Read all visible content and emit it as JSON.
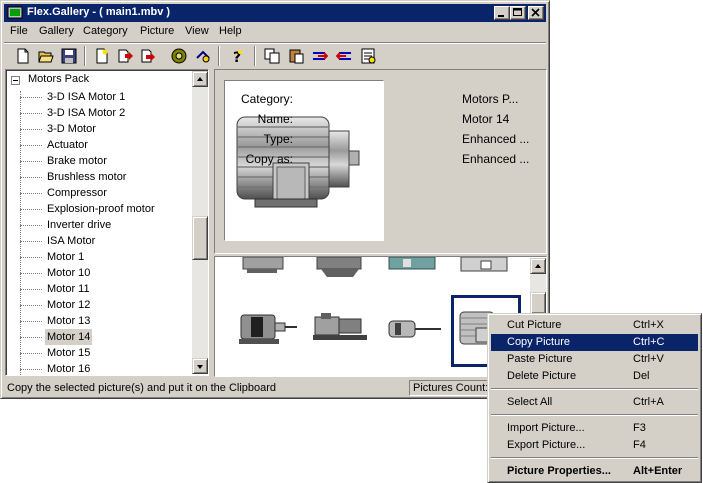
{
  "window": {
    "title": "Flex.Gallery - ( main1.mbv )"
  },
  "menubar": [
    "File",
    "Gallery",
    "Category",
    "Picture",
    "View",
    "Help"
  ],
  "toolbar": {
    "icons": [
      "new-icon",
      "open-icon",
      "save-icon",
      "new-page-icon",
      "add-picture-icon",
      "import-icon",
      "disk-icon",
      "settings-icon",
      "help-icon",
      "copy-icon",
      "paste-icon",
      "move-right-icon",
      "move-left-icon",
      "properties-icon"
    ]
  },
  "tree": {
    "root_label": "Motors  Pack",
    "items": [
      "3-D ISA Motor 1",
      "3-D ISA Motor 2",
      "3-D Motor",
      "Actuator",
      "Brake motor",
      "Brushless motor",
      "Compressor",
      "Explosion-proof motor",
      "Inverter drive",
      "ISA Motor",
      "Motor 1",
      "Motor 10",
      "Motor 11",
      "Motor 12",
      "Motor 13",
      "Motor 14",
      "Motor 15",
      "Motor 16"
    ],
    "selected": "Motor 14"
  },
  "info": {
    "category_label": "Category:",
    "category_value": "Motors  P...",
    "name_label": "Name:",
    "name_value": "Motor 14",
    "type_label": "Type:",
    "type_value": "Enhanced ...",
    "copyas_label": "Copy as:",
    "copyas_value": "Enhanced ..."
  },
  "status": {
    "text": "Copy the selected picture(s) and put it on the Clipboard",
    "count": "Pictures Count:"
  },
  "context_menu": [
    {
      "label": "Cut Picture",
      "shortcut": "Ctrl+X"
    },
    {
      "label": "Copy Picture",
      "shortcut": "Ctrl+C",
      "highlighted": true
    },
    {
      "label": "Paste Picture",
      "shortcut": "Ctrl+V"
    },
    {
      "label": "Delete Picture",
      "shortcut": "Del"
    },
    {
      "label": "Select All",
      "shortcut": "Ctrl+A"
    },
    {
      "label": "Import Picture...",
      "shortcut": "F3"
    },
    {
      "label": "Export Picture...",
      "shortcut": "F4"
    },
    {
      "label": "Picture Properties...",
      "shortcut": "Alt+Enter",
      "bold": true
    }
  ],
  "colors": {
    "titlebar": "#0a246a",
    "face": "#d4d0c8",
    "highlight": "#0a246a",
    "selection_border": "#0a246a"
  }
}
